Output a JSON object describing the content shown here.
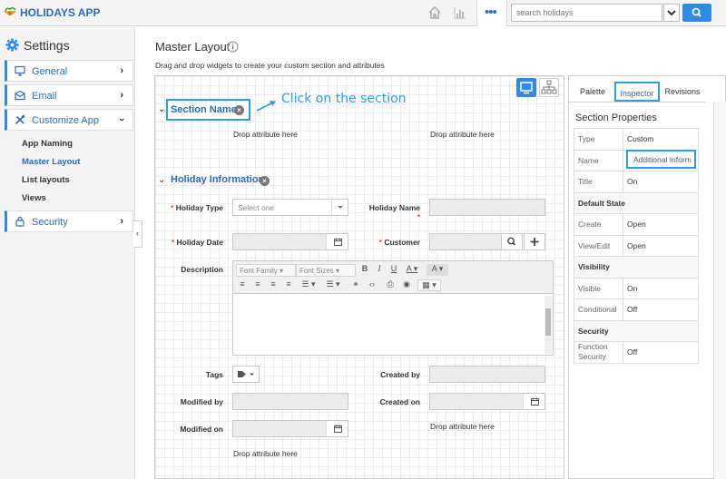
{
  "app": {
    "title": "HOLIDAYS APP"
  },
  "topbar": {
    "search_placeholder": "search holidays",
    "more_label": "•••"
  },
  "sidebar": {
    "title": "Settings",
    "items": [
      {
        "label": "General"
      },
      {
        "label": "Email"
      },
      {
        "label": "Customize App"
      }
    ],
    "subitems": [
      "App Naming",
      "Master Layout",
      "List layouts",
      "Views"
    ],
    "security": {
      "label": "Security"
    }
  },
  "main": {
    "title": "Master Layout",
    "subtitle": "Drag and drop widgets to create your custom section and attributes",
    "section1": {
      "name": "Section Name",
      "callout": "Click on the section",
      "drop1": "Drop attribute here",
      "drop2": "Drop attribute here"
    },
    "section2": {
      "name": "Holiday Information"
    },
    "fields": {
      "holiday_type": "Holiday Type",
      "holiday_type_placeholder": "Select one",
      "holiday_name": "Holiday Name",
      "holiday_date": "Holiday Date",
      "customer": "Customer",
      "description": "Description",
      "tags": "Tags",
      "created_by": "Created by",
      "modified_by": "Modified by",
      "created_on": "Created on",
      "modified_on": "Modified on",
      "drop_right": "Drop attribute here",
      "drop_bottom": "Drop attribute here",
      "required_mark": "*"
    },
    "editor": {
      "font_family": "Font Family",
      "font_sizes": "Font Sizes"
    }
  },
  "inspector": {
    "tabs": [
      "Palette",
      "Inspector",
      "Revisions"
    ],
    "title": "Section Properties",
    "rows": {
      "type": {
        "key": "Type",
        "value": "Custom"
      },
      "name": {
        "key": "Name",
        "value": "Additional Inform"
      },
      "title": {
        "key": "Title",
        "value": "On"
      },
      "default_state": "Default State",
      "create": {
        "key": "Create",
        "value": "Open"
      },
      "view_edit": {
        "key": "View/Edit",
        "value": "Open"
      },
      "visibility": "Visibility",
      "visible": {
        "key": "Visible",
        "value": "On"
      },
      "conditional": {
        "key": "Conditional",
        "value": "Off"
      },
      "security": "Security",
      "function_security": {
        "key": "Function Security",
        "value": "Off"
      }
    }
  },
  "colors": {
    "accent": "#2d8ae5",
    "highlight": "#2d9fd9",
    "link": "#2a6cb7"
  }
}
